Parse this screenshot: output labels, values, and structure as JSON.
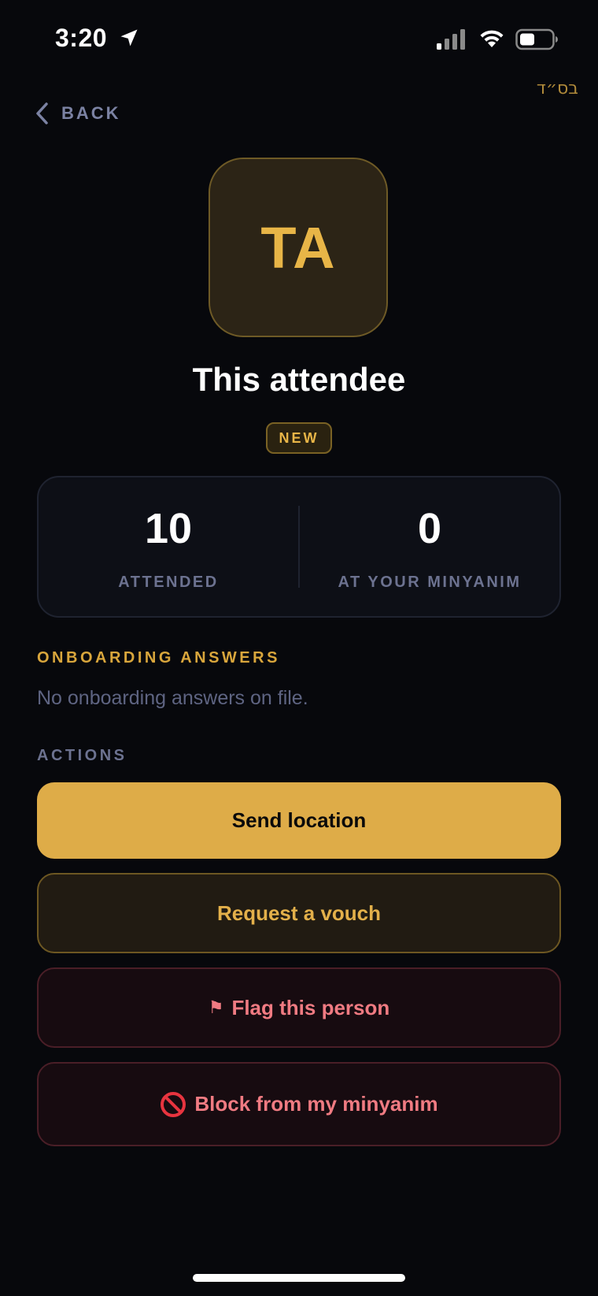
{
  "status_bar": {
    "time": "3:20",
    "icons": [
      "location-arrow-icon",
      "cellular-signal-icon",
      "wifi-icon",
      "battery-icon"
    ]
  },
  "header": {
    "bsd": "בס״ד",
    "back_label": "BACK"
  },
  "profile": {
    "initials": "TA",
    "name": "This attendee",
    "badge": "NEW"
  },
  "stats": [
    {
      "value": "10",
      "label": "ATTENDED"
    },
    {
      "value": "0",
      "label": "AT YOUR MINYANIM"
    }
  ],
  "onboarding": {
    "heading": "ONBOARDING ANSWERS",
    "empty_text": "No onboarding answers on file."
  },
  "actions": {
    "heading": "ACTIONS",
    "send_location": "Send location",
    "request_vouch": "Request a vouch",
    "flag_icon": "⚑",
    "flag_person": "Flag this person",
    "block_icon": "no-entry-icon",
    "block_label": "Block from my minyanim"
  },
  "colors": {
    "background": "#07080c",
    "accent_gold": "#deac48",
    "danger": "#f07b82",
    "muted": "#6c7290"
  }
}
